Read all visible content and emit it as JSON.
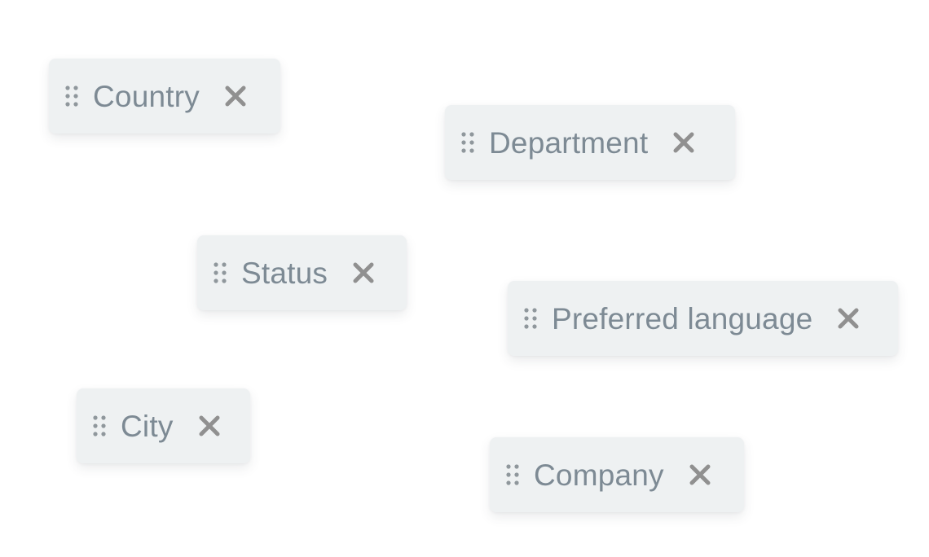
{
  "chips": [
    {
      "label": "Country",
      "grip_icon": "drag-handle-icon",
      "remove_icon": "close-icon"
    },
    {
      "label": "Department",
      "grip_icon": "drag-handle-icon",
      "remove_icon": "close-icon"
    },
    {
      "label": "Status",
      "grip_icon": "drag-handle-icon",
      "remove_icon": "close-icon"
    },
    {
      "label": "Preferred language",
      "grip_icon": "drag-handle-icon",
      "remove_icon": "close-icon"
    },
    {
      "label": "City",
      "grip_icon": "drag-handle-icon",
      "remove_icon": "close-icon"
    },
    {
      "label": "Company",
      "grip_icon": "drag-handle-icon",
      "remove_icon": "close-icon"
    }
  ],
  "colors": {
    "chip_background": "#eef1f2",
    "label_text": "#7d8a94",
    "grip_dots": "#8f979c",
    "close_icon": "#909090"
  }
}
